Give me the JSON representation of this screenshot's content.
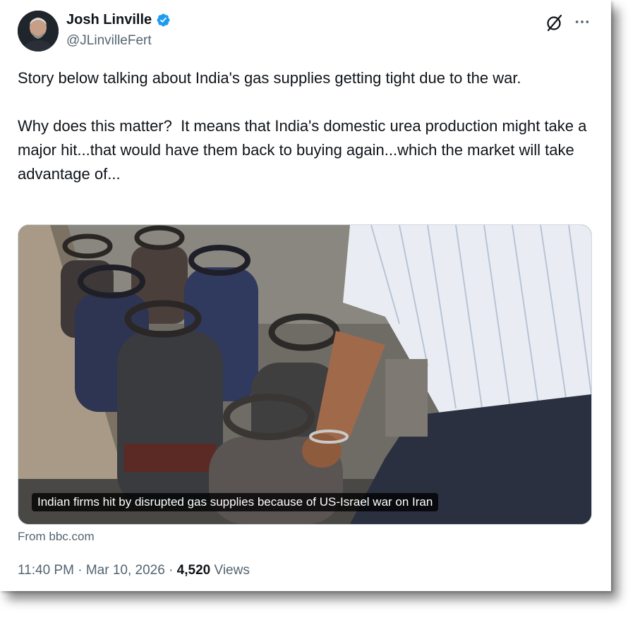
{
  "author": {
    "display_name": "Josh Linville",
    "handle": "@JLinvilleFert"
  },
  "tweet": {
    "text": "Story below talking about India's gas supplies getting tight due to the war.\n\nWhy does this matter?  It means that India's domestic urea production might take a major hit...that would have them back to buying again...which the market will take advantage of..."
  },
  "card": {
    "caption": "Indian firms hit by disrupted gas supplies because of US-Israel war on Iran",
    "source": "From bbc.com"
  },
  "meta": {
    "time": "11:40 PM",
    "separator": "·",
    "date": "Mar 10, 2026",
    "views_count": "4,520",
    "views_label": "Views"
  },
  "icons": {
    "verified": "verified-badge-icon",
    "grok": "grok-icon",
    "more": "more-options-icon"
  },
  "colors": {
    "text_primary": "#0f1419",
    "text_secondary": "#536471",
    "verified_blue": "#1d9bf0"
  }
}
